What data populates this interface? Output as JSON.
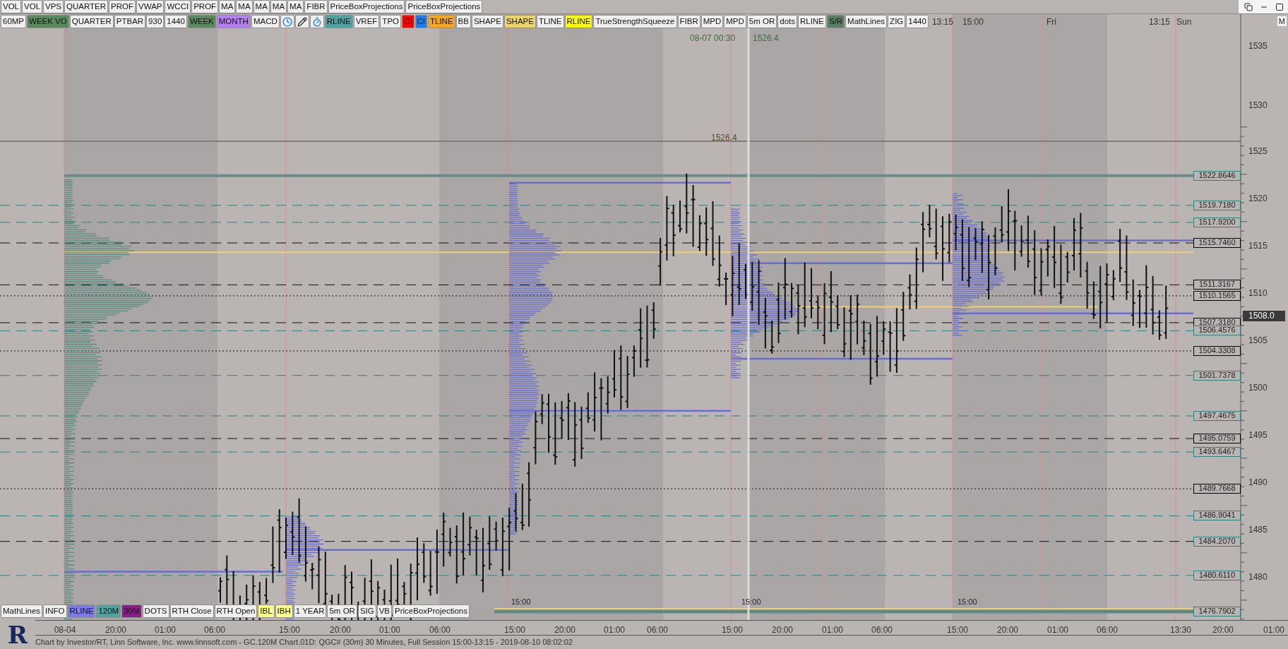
{
  "toolbar_top": [
    {
      "label": "VOL",
      "color": "#efefef"
    },
    {
      "label": "VOL",
      "color": "#efefef"
    },
    {
      "label": "VPS",
      "color": "#efefef"
    },
    {
      "label": "QUARTER",
      "color": "#efefef"
    },
    {
      "label": "PROF",
      "color": "#efefef"
    },
    {
      "label": "VWAP",
      "color": "#efefef"
    },
    {
      "label": "WCCI",
      "color": "#efefef"
    },
    {
      "label": "PROF",
      "color": "#efefef"
    },
    {
      "label": "MA",
      "color": "#efefef"
    },
    {
      "label": "MA",
      "color": "#efefef"
    },
    {
      "label": "MA",
      "color": "#efefef"
    },
    {
      "label": "MA",
      "color": "#efefef"
    },
    {
      "label": "MA",
      "color": "#efefef"
    },
    {
      "label": "FIBR",
      "color": "#efefef"
    },
    {
      "label": "PriceBoxProjections",
      "color": "#efefef"
    },
    {
      "label": "PriceBoxProjections",
      "color": "#efefef"
    }
  ],
  "toolbar_chart": [
    {
      "kind": "text",
      "label": "60MP",
      "color": "#efefef"
    },
    {
      "kind": "text",
      "label": "WEEK VO",
      "color": "#5b8a5f"
    },
    {
      "kind": "text",
      "label": "QUARTER",
      "color": "#efefef"
    },
    {
      "kind": "text",
      "label": "PTBAR",
      "color": "#efefef"
    },
    {
      "kind": "text",
      "label": "930",
      "color": "#efefef"
    },
    {
      "kind": "text",
      "label": "1440",
      "color": "#efefef"
    },
    {
      "kind": "text",
      "label": "WEEK",
      "color": "#5b8a5f"
    },
    {
      "kind": "text",
      "label": "MONTH",
      "color": "#b57ff0"
    },
    {
      "kind": "text",
      "label": "MACD",
      "color": "#efefef"
    },
    {
      "kind": "clock"
    },
    {
      "kind": "pencil"
    },
    {
      "kind": "timer"
    },
    {
      "kind": "text",
      "label": "RLINE",
      "color": "#4fa3a3"
    },
    {
      "kind": "text",
      "label": "VREF",
      "color": "#efefef"
    },
    {
      "kind": "text",
      "label": "TPO",
      "color": "#efefef"
    },
    {
      "kind": "text",
      "label": "CI",
      "color": "#ff0000"
    },
    {
      "kind": "text",
      "label": "CI",
      "color": "#1a7ff0"
    },
    {
      "kind": "text",
      "label": "TLINE",
      "color": "#f5a623"
    },
    {
      "kind": "text",
      "label": "BB",
      "color": "#efefef"
    },
    {
      "kind": "text",
      "label": "SHAPE",
      "color": "#efefef"
    },
    {
      "kind": "text",
      "label": "SHAPE",
      "color": "#ecd36a"
    },
    {
      "kind": "text",
      "label": "TLINE",
      "color": "#efefef"
    },
    {
      "kind": "text",
      "label": "RLINE",
      "color": "#ffff00"
    },
    {
      "kind": "text",
      "label": "TrueStrengthSqueeze",
      "color": "#efefef"
    },
    {
      "kind": "text",
      "label": "FIBR",
      "color": "#efefef"
    },
    {
      "kind": "text",
      "label": "MPD",
      "color": "#efefef"
    },
    {
      "kind": "text",
      "label": "MPD",
      "color": "#efefef"
    },
    {
      "kind": "text",
      "label": "5m OR",
      "color": "#efefef"
    },
    {
      "kind": "text",
      "label": "dots",
      "color": "#efefef"
    },
    {
      "kind": "text",
      "label": "RLINE",
      "color": "#efefef"
    },
    {
      "kind": "text",
      "label": "S/R",
      "color": "#5b7f62"
    },
    {
      "kind": "text",
      "label": "MathLines",
      "color": "#efefef"
    },
    {
      "kind": "text",
      "label": "ZIG",
      "color": "#efefef"
    },
    {
      "kind": "text",
      "label": "1440",
      "color": "#efefef"
    }
  ],
  "header_time_labels": [
    "13:15",
    "15:00",
    "Fri",
    "13:15",
    "Sun"
  ],
  "pane_button": "M",
  "crosshair": {
    "time": "08-07 00:30",
    "price": "1526.4"
  },
  "marker_price": "1526.4",
  "session_labels": [
    "15:00",
    "15:00",
    "15:00"
  ],
  "upper_axis_labels": [
    "1535",
    "1530"
  ],
  "price_axis_labels": [
    "1525",
    "1520",
    "1515",
    "1510",
    "1505",
    "1500",
    "1495",
    "1490",
    "1485",
    "1480"
  ],
  "level_tags": [
    {
      "text": "1522.8646",
      "color": "#2f8080"
    },
    {
      "text": "1519.7180",
      "color": "#2f8080"
    },
    {
      "text": "1517.9200",
      "color": "#2f8080"
    },
    {
      "text": "1515.7460",
      "color": "#000000"
    },
    {
      "text": "1511.3167",
      "color": "#000000"
    },
    {
      "text": "1510.1565",
      "color": "#000000"
    },
    {
      "text": "1507.3180",
      "color": "#000000"
    },
    {
      "text": "1506.4576",
      "color": "#2f8080"
    },
    {
      "text": "1504.3308",
      "color": "#000000"
    },
    {
      "text": "1501.7378",
      "color": "#2f8080"
    },
    {
      "text": "1497.4675",
      "color": "#2f8080"
    },
    {
      "text": "1495.0759",
      "color": "#000000"
    },
    {
      "text": "1493.6467",
      "color": "#2f8080"
    },
    {
      "text": "1489.7668",
      "color": "#000000"
    },
    {
      "text": "1486.9041",
      "color": "#2f8080"
    },
    {
      "text": "1484.2070",
      "color": "#2f8080"
    },
    {
      "text": "1480.6110",
      "color": "#2f8080"
    },
    {
      "text": "1476.7902",
      "color": "#2f8080"
    }
  ],
  "last_price": "1508.0",
  "toolbar_bottom": [
    {
      "label": "MathLines",
      "color": "#efefef"
    },
    {
      "label": "INFO",
      "color": "#efefef"
    },
    {
      "label": "RLINE",
      "color": "#7b7bef"
    },
    {
      "label": "120M",
      "color": "#4fa3a3"
    },
    {
      "label": "30M",
      "color": "#8e1a8e"
    },
    {
      "label": "DOTS",
      "color": "#efefef"
    },
    {
      "label": "RTH Close",
      "color": "#efefef"
    },
    {
      "label": "RTH Open",
      "color": "#efefef"
    },
    {
      "label": "IBL",
      "color": "#ffff80"
    },
    {
      "label": "IBH",
      "color": "#ffff80"
    },
    {
      "label": "1 YEAR",
      "color": "#efefef"
    },
    {
      "label": "5m OR",
      "color": "#efefef"
    },
    {
      "label": "SIG",
      "color": "#efefef"
    },
    {
      "label": "VB",
      "color": "#efefef"
    },
    {
      "label": "PriceBoxProjections",
      "color": "#efefef"
    }
  ],
  "time_axis": [
    "08-04",
    "20:00",
    "01:00",
    "06:00",
    "15:00",
    "20:00",
    "01:00",
    "06:00",
    "15:00",
    "20:00",
    "01:00",
    "06:00",
    "15:00",
    "20:00",
    "01:00",
    "06:00",
    "15:00",
    "20:00",
    "01:00",
    "06:00",
    "13:30",
    "20:00",
    "01:00"
  ],
  "logo_letter": "R",
  "status_text": "Chart by Investor/RT, Linn Software, Inc. www.linnsoft.com - GC.120M Chart.01D: QGC# (30m) 30 Minutes, Full Session 15:00-13:15 - 2019-08-10 08:02:02"
}
